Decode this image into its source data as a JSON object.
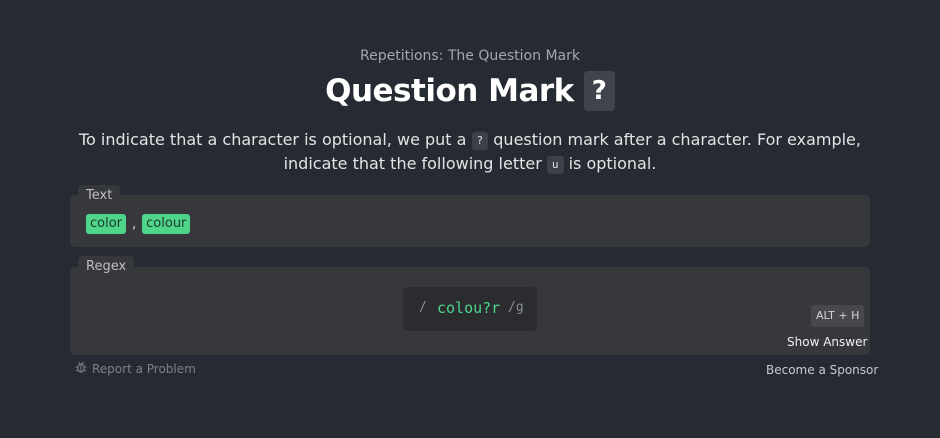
{
  "header": {
    "subtitle": "Repetitions: The Question Mark",
    "title": "Question Mark",
    "title_badge": "?"
  },
  "description": {
    "part1": "To indicate that a character is optional, we put a",
    "chip1": "?",
    "part2": "question mark after a character. For example,",
    "part3": "indicate that the following letter",
    "chip2": "u",
    "part4": "is optional."
  },
  "text_panel": {
    "label": "Text",
    "matches": [
      "color",
      "colour"
    ],
    "separator": ","
  },
  "regex_panel": {
    "label": "Regex",
    "open_slash": "/",
    "value": "colou?r",
    "flags": "/g",
    "shortcut": "ALT + H",
    "show_answer": "Show Answer"
  },
  "footer": {
    "report": "Report a Problem",
    "sponsor": "Become a Sponsor"
  },
  "colors": {
    "background": "#262a33",
    "match_highlight": "#4ed58a",
    "panel": "#36383c"
  }
}
